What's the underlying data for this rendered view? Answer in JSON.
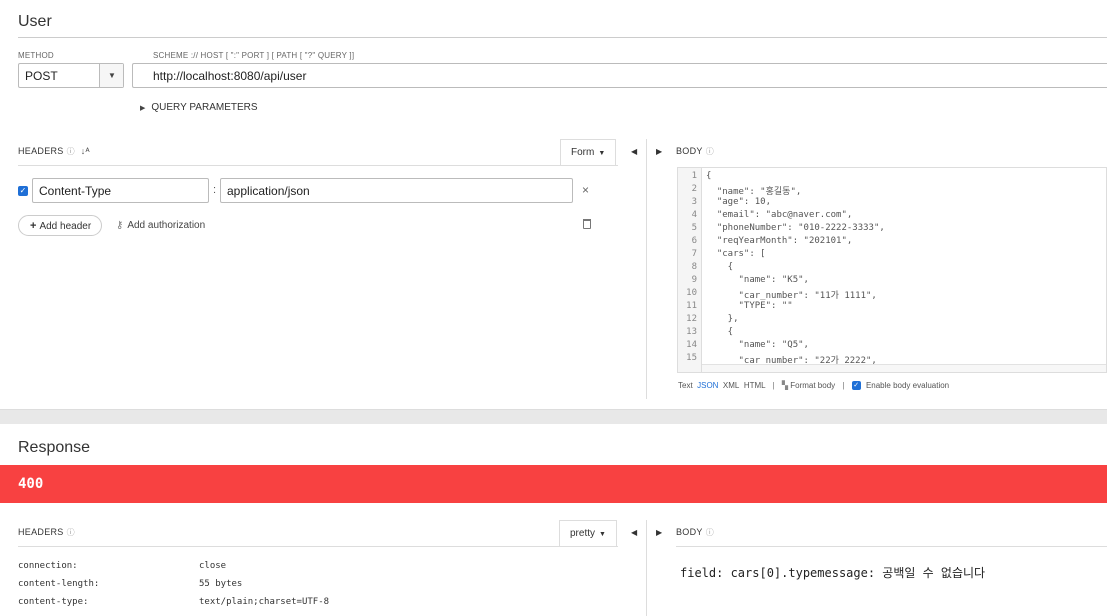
{
  "request": {
    "title": "User",
    "method_label": "METHOD",
    "method_value": "POST",
    "scheme_label": "SCHEME :// HOST [ \":\" PORT ] [ PATH [ \"?\" QUERY ]]",
    "url": "http://localhost:8080/api/user",
    "query_parameters_label": "QUERY PARAMETERS",
    "headers_label": "HEADERS",
    "headers_mode": "Form",
    "headers": [
      {
        "enabled": true,
        "name": "Content-Type",
        "value": "application/json"
      }
    ],
    "add_header_label": "Add header",
    "add_authorization_label": "Add authorization",
    "body_label": "BODY",
    "body_lines": [
      "{",
      "  \"name\": \"홍길동\",",
      "  \"age\": 10,",
      "  \"email\": \"abc@naver.com\",",
      "  \"phoneNumber\": \"010-2222-3333\",",
      "  \"reqYearMonth\": \"202101\",",
      "  \"cars\": [",
      "    {",
      "      \"name\": \"K5\",",
      "      \"car_number\": \"11가 1111\",",
      "      \"TYPE\": \"\"",
      "    },",
      "    {",
      "      \"name\": \"Q5\",",
      "      \"car_number\": \"22가 2222\","
    ],
    "body_formats": [
      "Text",
      "JSON",
      "XML",
      "HTML"
    ],
    "body_format_active": "JSON",
    "format_body_label": "Format body",
    "enable_eval_label": "Enable body evaluation"
  },
  "response": {
    "title": "Response",
    "status": "400",
    "status_color": "#f84141",
    "headers_label": "HEADERS",
    "headers_mode": "pretty",
    "headers": [
      {
        "name": "connection:",
        "value": "close"
      },
      {
        "name": "content-length:",
        "value": "55 bytes"
      },
      {
        "name": "content-type:",
        "value": "text/plain;charset=UTF-8"
      }
    ],
    "body_label": "BODY",
    "body_text": "field: cars[0].typemessage: 공백일 수 없습니다"
  }
}
